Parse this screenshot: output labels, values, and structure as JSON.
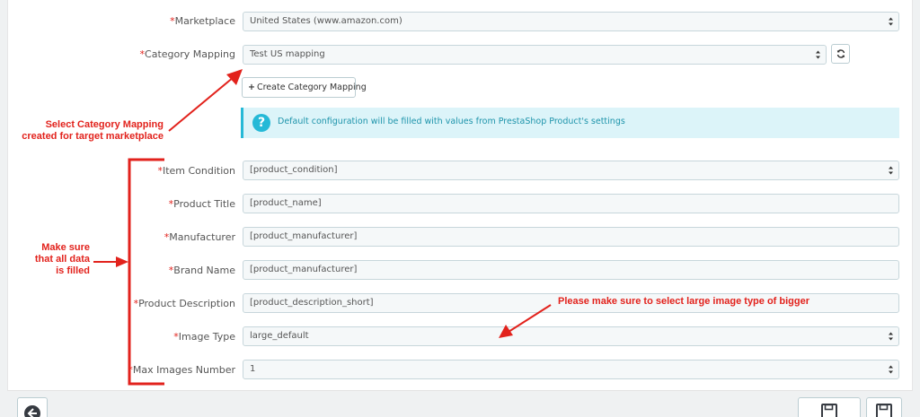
{
  "form": {
    "required_mark": "*",
    "marketplace": {
      "label": "Marketplace",
      "value": "United States (www.amazon.com)"
    },
    "category_mapping": {
      "label": "Category Mapping",
      "value": "Test US mapping"
    },
    "create_mapping_button": "Create Category Mapping",
    "info_text": "Default configuration will be filled with values from PrestaShop Product's settings",
    "item_condition": {
      "label": "Item Condition",
      "value": "[product_condition]"
    },
    "product_title": {
      "label": "Product Title",
      "value": "[product_name]"
    },
    "manufacturer": {
      "label": "Manufacturer",
      "value": "[product_manufacturer]"
    },
    "brand_name": {
      "label": "Brand Name",
      "value": "[product_manufacturer]"
    },
    "product_description": {
      "label": "Product Description",
      "value": "[product_description_short]"
    },
    "image_type": {
      "label": "Image Type",
      "value": "large_default"
    },
    "max_images": {
      "label": "Max Images Number",
      "value": "1"
    }
  },
  "annotations": {
    "select_mapping_line1": "Select Category Mapping",
    "select_mapping_line2": "created for target marketplace",
    "make_sure_line1": "Make sure",
    "make_sure_line2": "that all data",
    "make_sure_line3": "is filled",
    "image_note": "Please make sure to select large image type of bigger"
  },
  "colors": {
    "annotation": "#e2221c",
    "required": "#e2221c",
    "info_bg": "#dcf4f9",
    "info_accent": "#25b9d7"
  },
  "icons": {
    "refresh": "refresh-icon",
    "help": "question-circle-icon",
    "back": "arrow-left-circle-icon",
    "save": "floppy-disk-icon"
  }
}
